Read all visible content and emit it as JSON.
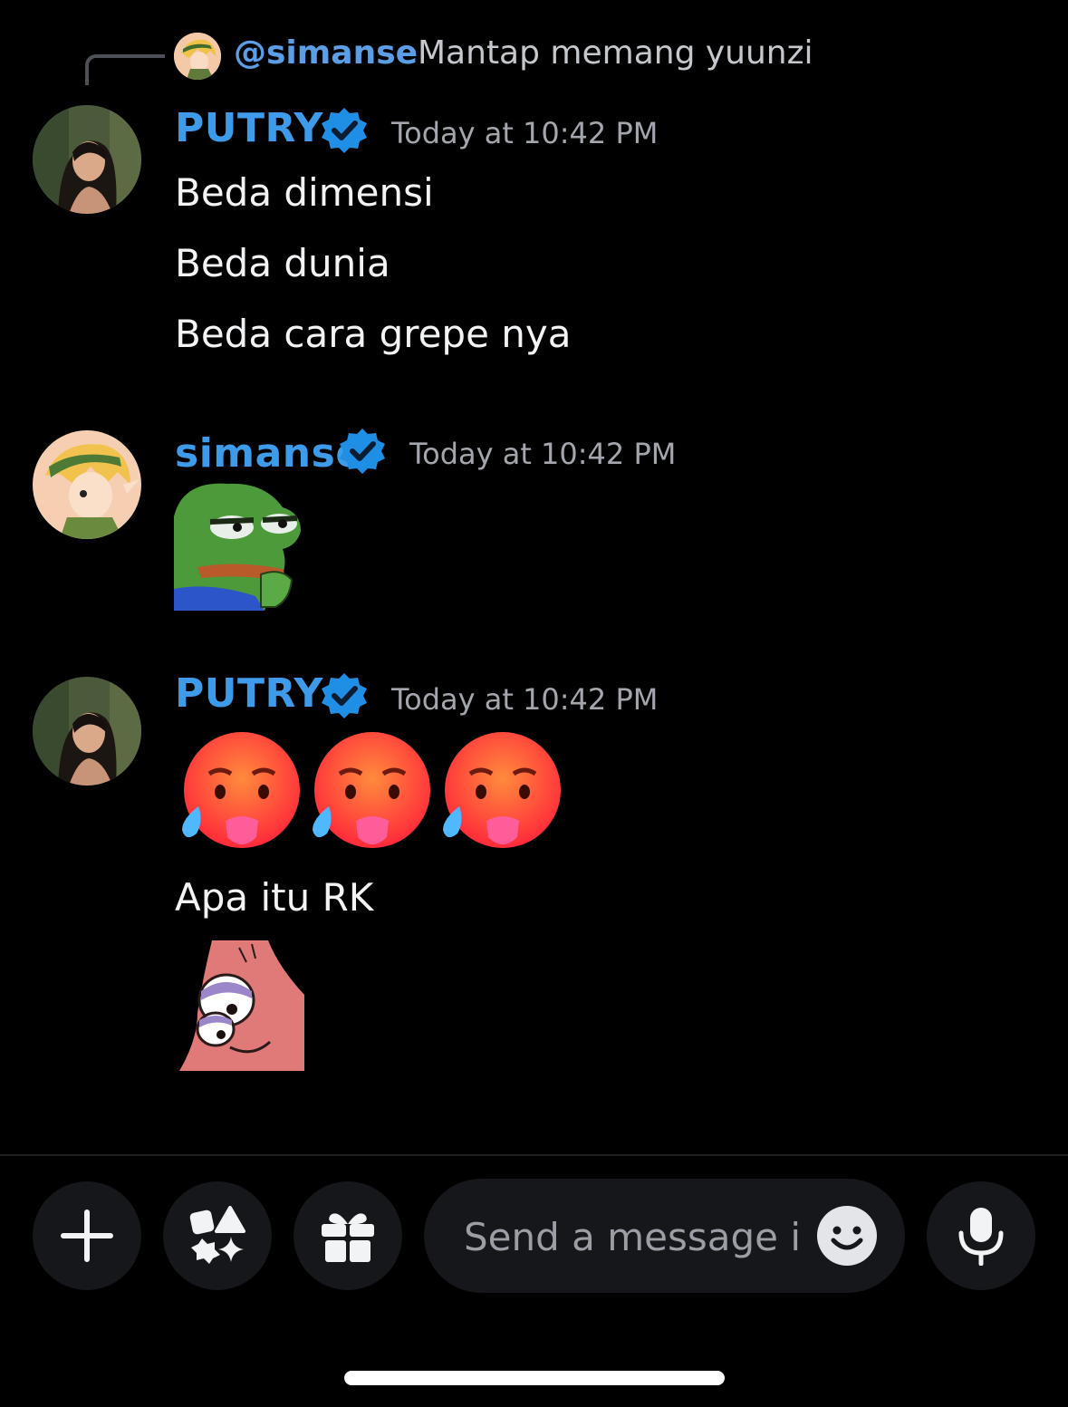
{
  "reply": {
    "username": "@simanse",
    "text": "Mantap memang yuunzi"
  },
  "messages": [
    {
      "username": "PUTRY",
      "timestamp": "Today at 10:42 PM",
      "lines": [
        "Beda dimensi",
        "Beda dunia",
        "Beda cara grepe nya"
      ]
    },
    {
      "username": "simanse",
      "timestamp": "Today at 10:42 PM",
      "sticker": "pepe-frog-sticker"
    },
    {
      "username": "PUTRY",
      "timestamp": "Today at 10:42 PM",
      "emoji_count": 3,
      "lines": [
        "Apa itu RK"
      ],
      "sticker": "patrick-star-sticker"
    }
  ],
  "composer": {
    "placeholder": "Send a message i.."
  },
  "colors": {
    "background": "#000000",
    "username": "#3d9be9",
    "verified": "#1f8fe5",
    "timestamp": "#a3a6ad",
    "input_bg": "#16171a"
  }
}
